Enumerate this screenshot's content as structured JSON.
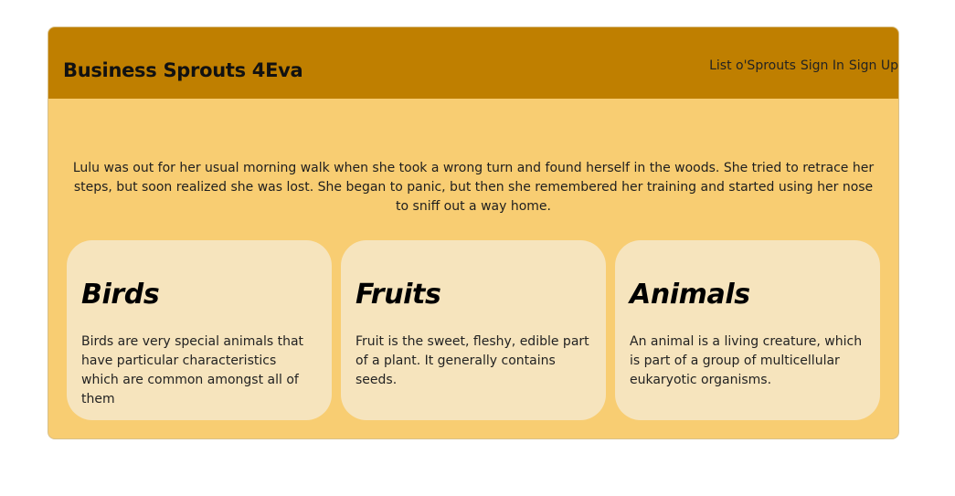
{
  "header": {
    "brand": "Business Sprouts 4Eva",
    "nav": [
      {
        "label": "List o'Sprouts"
      },
      {
        "label": "Sign In"
      },
      {
        "label": "Sign Up"
      }
    ]
  },
  "intro": {
    "text": "Lulu was out for her usual morning walk when she took a wrong turn and found herself in the woods. She tried to retrace her steps, but soon realized she was lost. She began to panic, but then she remembered her training and started using her nose to sniff out a way home."
  },
  "cards": [
    {
      "title": "Birds",
      "text": "Birds are very special animals that have particular characteristics which are common amongst all of them"
    },
    {
      "title": "Fruits",
      "text": "Fruit is the sweet, fleshy, edible part of a plant. It generally contains seeds."
    },
    {
      "title": "Animals",
      "text": "An animal is a living creature, which is part of a group of multicellular eukaryotic organisms."
    }
  ],
  "colors": {
    "header_bg": "#bf7f00",
    "page_bg": "#f8cd72",
    "card_bg": "#f6e4bd"
  }
}
